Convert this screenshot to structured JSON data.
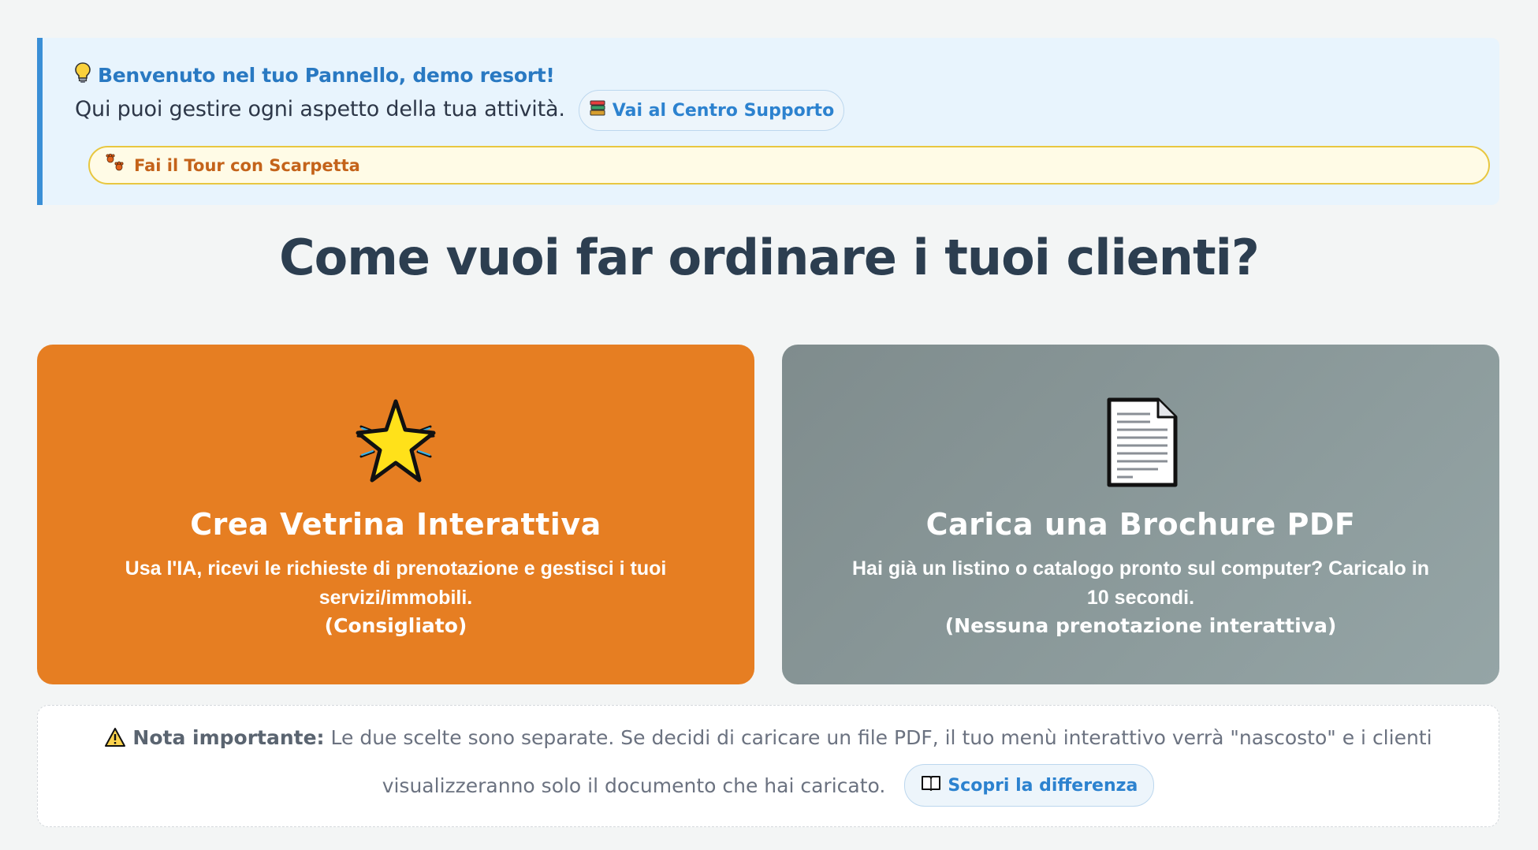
{
  "welcome": {
    "title": "Benvenuto nel tuo Pannello, demo resort!",
    "description": "Qui puoi gestire ogni aspetto della tua attività.",
    "support_button": "Vai al Centro Supporto",
    "tour_button": "Fai il Tour con Scarpetta",
    "icons": {
      "title": "lightbulb-icon",
      "support": "books-icon",
      "tour": "paw-prints-icon"
    }
  },
  "heading": "Come vuoi far ordinare i tuoi clienti?",
  "options": [
    {
      "icon": "sparkle-star-icon",
      "title": "Crea Vetrina Interattiva",
      "description": "Usa l'IA, ricevi le richieste di prenotazione e gestisci i tuoi servizi/immobili.",
      "note": "(Consigliato)",
      "color": "#e67e22"
    },
    {
      "icon": "document-icon",
      "title": "Carica una Brochure PDF",
      "description": "Hai già un listino o catalogo pronto sul computer? Caricalo in 10 secondi.",
      "note": "(Nessuna prenotazione interattiva)",
      "color": "#7f8c8d"
    }
  ],
  "notice": {
    "label": "Nota importante:",
    "text_part1": "Le due scelte sono separate. Se decidi di caricare un file PDF, il tuo menù interattivo verrà \"nascosto\" e i clienti",
    "text_part2": "visualizzeranno solo il documento che hai caricato.",
    "button": "Scopri la differenza",
    "icons": {
      "notice": "warning-icon",
      "button": "open-book-icon"
    }
  }
}
